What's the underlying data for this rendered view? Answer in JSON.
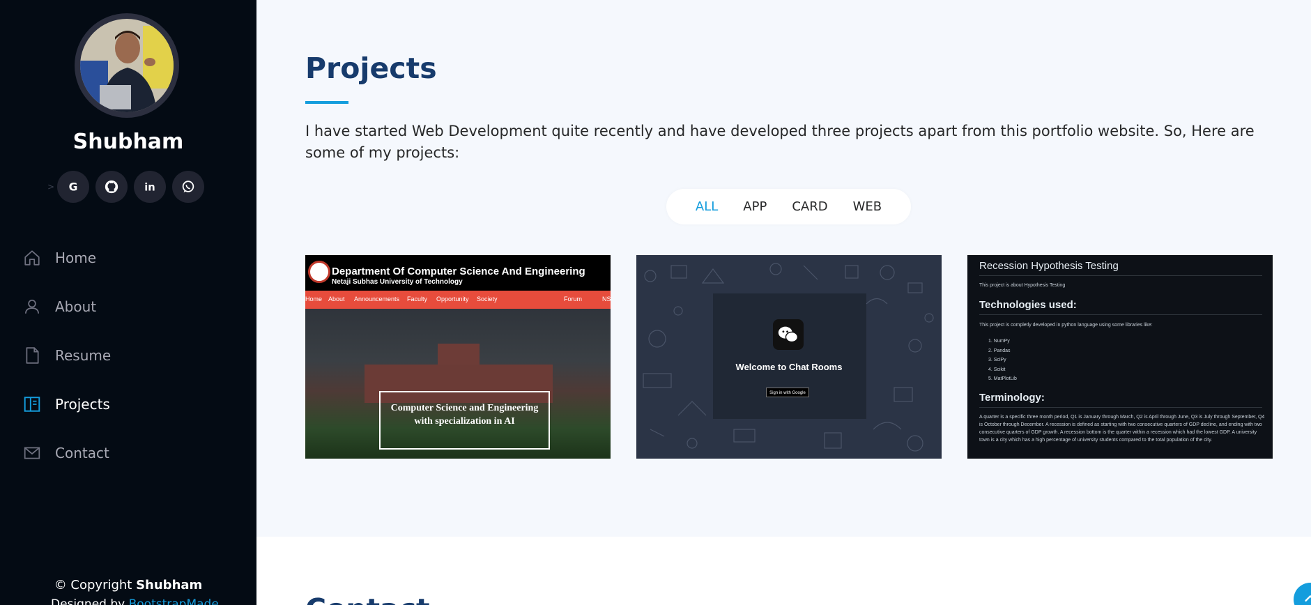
{
  "sidebar": {
    "profile_name": "Shubham",
    "social": [
      {
        "icon": "google-icon",
        "label": "G"
      },
      {
        "icon": "github-icon"
      },
      {
        "icon": "linkedin-icon",
        "label": "in"
      },
      {
        "icon": "whatsapp-icon"
      }
    ],
    "nav": [
      {
        "label": "Home",
        "icon": "home-icon"
      },
      {
        "label": "About",
        "icon": "user-icon"
      },
      {
        "label": "Resume",
        "icon": "file-icon"
      },
      {
        "label": "Projects",
        "icon": "book-icon",
        "active": true
      },
      {
        "label": "Contact",
        "icon": "envelope-icon"
      }
    ],
    "copyright_prefix": "© Copyright ",
    "copyright_name": "Shubham",
    "designed_prefix": "Designed by ",
    "designed_link": "BootstrapMade"
  },
  "projects": {
    "title": "Projects",
    "intro": "I have started Web Development quite recently and have developed three projects apart from this portfolio website. So, Here are some of my projects:",
    "filters": [
      "ALL",
      "APP",
      "CARD",
      "WEB"
    ],
    "active_filter": "ALL",
    "cards": [
      {
        "header_title": "Department Of Computer Science And Engineering",
        "header_subtitle": "Netaji Subhas University of Technology",
        "nav": [
          "Home",
          "About",
          "Announcements",
          "Faculty",
          "Opportunity",
          "Society",
          "Forum",
          "NS"
        ],
        "banner": "Computer Science and Engineering with specialization in AI"
      },
      {
        "title": "Welcome to Chat Rooms",
        "button": "Sign in with Google"
      },
      {
        "title": "Recession Hypothesis Testing",
        "about": "This project is about Hypothesis Testing",
        "tech_heading": "Technologies used:",
        "tech_text": "This project is completly developed in python language using some libraries like:",
        "libraries": [
          "1. NumPy",
          "2. Pandas",
          "3. SciPy",
          "4. Scikit",
          "5. MatPlotLib"
        ],
        "term_heading": "Terminology:",
        "term_text": "A quarter is a specific three month period, Q1 is January through March, Q2 is April through June, Q3 is July through September, Q4 is October through December. A recession is defined as starting with two consecutive quarters of GDP decline, and ending with two consecutive quarters of GDP growth. A recession bottom is the quarter within a recession which had the lowest GDP. A university town is a city which has a high percentage of university students compared to the total population of the city."
      }
    ]
  },
  "contact": {
    "title": "Contact"
  },
  "colors": {
    "accent": "#149ddd",
    "sidebar_bg": "#040b14",
    "heading": "#173b6c"
  }
}
